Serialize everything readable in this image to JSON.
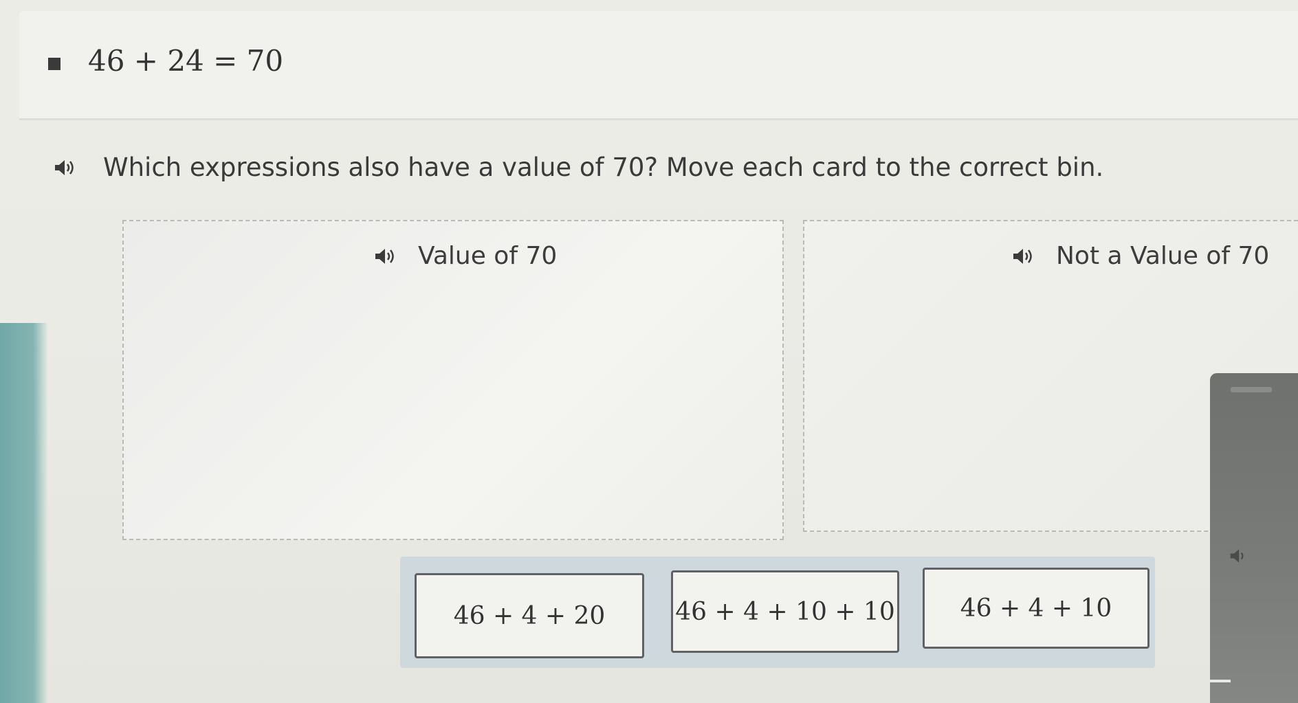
{
  "given": {
    "expression": "46 + 24 = 70"
  },
  "prompt": {
    "text": "Which expressions also have a value of 70? Move each card to the correct bin."
  },
  "bins": [
    {
      "label": "Value of 70"
    },
    {
      "label": "Not a Value of 70"
    }
  ],
  "cards": [
    {
      "expression": "46 + 4 + 20"
    },
    {
      "expression": "46 + 4 + 10 + 10"
    },
    {
      "expression": "46 + 4 + 10"
    }
  ],
  "icons": {
    "speaker": "speaker-icon",
    "bullet": "bullet-square-icon"
  },
  "colors": {
    "tray": "#cfd9dd",
    "card_border": "#5f6164",
    "text": "#333333"
  }
}
